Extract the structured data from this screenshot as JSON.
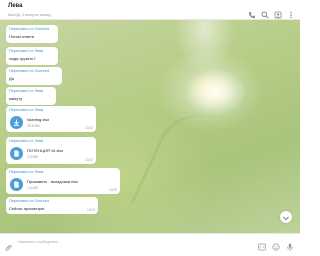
{
  "header": {
    "chat_name": "Лева",
    "status": "был(а) 3 минуты назад",
    "icons": [
      "phone-icon",
      "search-icon",
      "account-icon",
      "more-icon"
    ]
  },
  "messages": [
    {
      "forwarded": "Переслано от Overlord",
      "text": "Потом ответи",
      "time": "13:00"
    },
    {
      "forwarded": "Переслано от Лева",
      "text": "сюда грузить?",
      "time": "13:00"
    },
    {
      "forwarded": "Переслано от Overlord",
      "text": "Да",
      "time": "13:01"
    },
    {
      "forwarded": "Переслано от Лева",
      "text": "минуту",
      "time": "13:01"
    },
    {
      "forwarded": "Переслано от Лева",
      "file_name": "Istarting.xlsx",
      "file_size": "49.8 MB",
      "time": "13:02"
    },
    {
      "forwarded": "Переслано от Лева",
      "file_name": "ПОТЕНЦИЯ 10.xlsx",
      "file_size": "3.8 MB",
      "time": "13:02"
    },
    {
      "forwarded": "Переслано от Лева",
      "file_name": "Прожаветь - вкладчики.xlsx",
      "file_size": "1.6 MB",
      "time": "13:02"
    },
    {
      "forwarded": "Переслано от Overlord",
      "text": "Сейчас просмотрю",
      "time": "13:03"
    }
  ],
  "composer": {
    "placeholder": "Написать сообщение...",
    "icons": [
      "attach-icon",
      "command-icon",
      "emoji-icon",
      "microphone-icon"
    ]
  }
}
